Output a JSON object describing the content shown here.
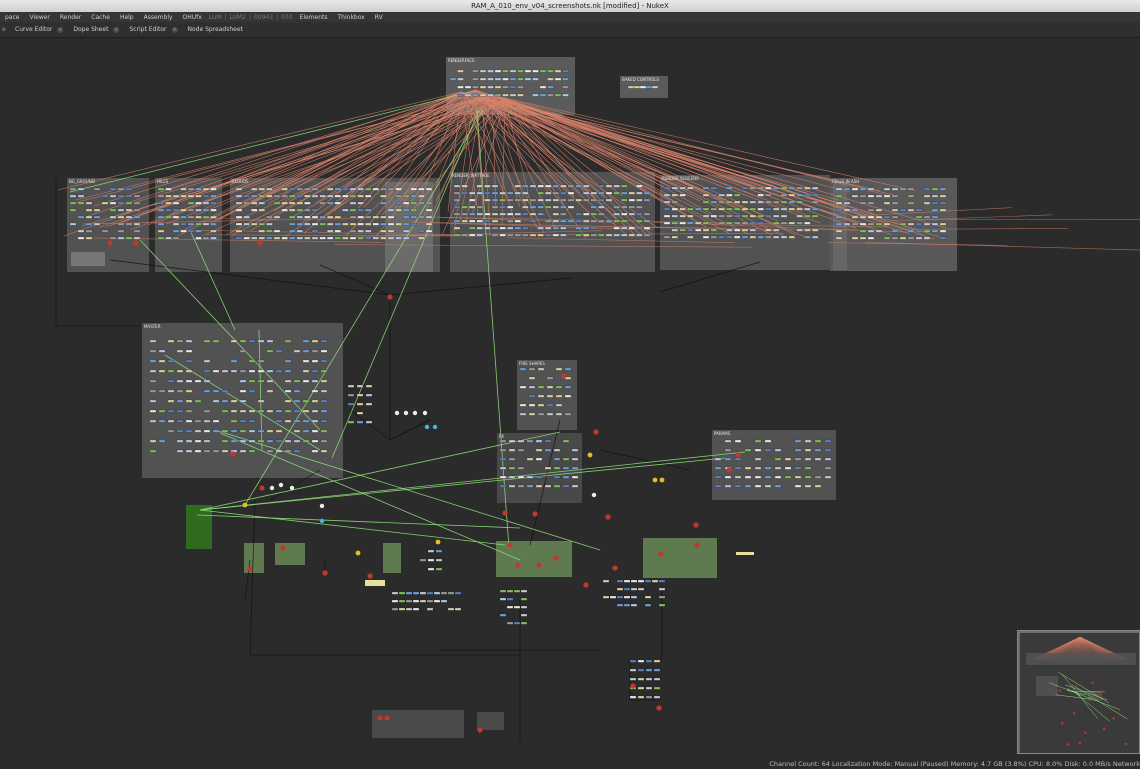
{
  "window": {
    "title": "RAM_A_010_env_v04_screenshots.nk [modified] - NukeX"
  },
  "menubar": {
    "items": [
      "pace",
      "Viewer",
      "Render",
      "Cache",
      "Help",
      "Assembly",
      "OHUfx"
    ],
    "dim_items": [
      "LUM",
      "LUM2",
      "00943",
      "070"
    ],
    "items_right": [
      "Elements",
      "Thinkbox",
      "RV"
    ]
  },
  "tabs": [
    "Curve Editor",
    "Dope Sheet",
    "Script Editor",
    "Node Spreadsheet"
  ],
  "tab_lead": "e",
  "backdrops": [
    {
      "label": "RENDERFACE"
    },
    {
      "label": "BAKED CONTROLS"
    },
    {
      "label": "BG_GROUND"
    },
    {
      "label": "HILLS"
    },
    {
      "label": "CLOUDS"
    },
    {
      "label": "RENDER_WATTAGE"
    },
    {
      "label": "RENDER SCREENS"
    },
    {
      "label": "CELLS IN ASH"
    },
    {
      "label": "MASTER"
    },
    {
      "label": "FIRE SHAPES"
    },
    {
      "label": "FX"
    },
    {
      "label": "PARAMS"
    }
  ],
  "statusbar": {
    "text": "Channel Count: 64  Localization Mode: Manual (Paused)  Memory: 4.7 GB (3.8%)  CPU: 8.0%  Disk: 0.0 MB/s  Network"
  },
  "colors": {
    "background": "#2b2b2b",
    "link_orange": "#d9826a",
    "link_green": "#8ee07a",
    "backdrop": "#5a5a5a",
    "backdrop_green": "#2e6b1e",
    "node_red": "#c0392b"
  }
}
